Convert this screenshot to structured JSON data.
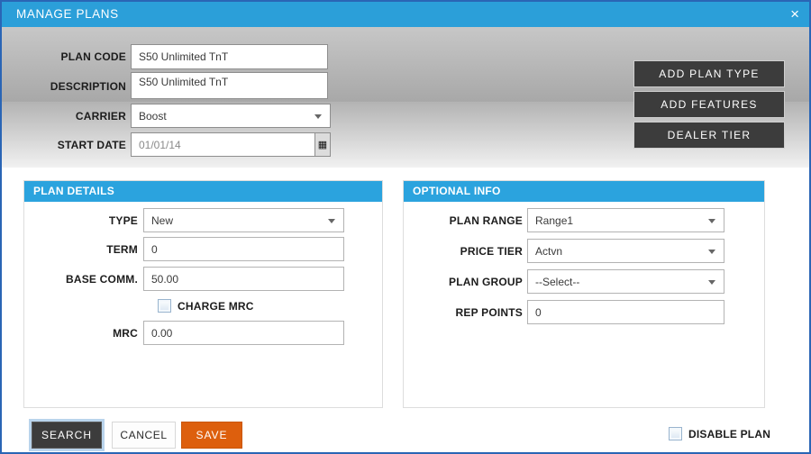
{
  "titlebar": {
    "title": "MANAGE PLANS",
    "close_glyph": "×"
  },
  "header": {
    "plan_code": {
      "label": "PLAN CODE",
      "value": "S50 Unlimited TnT"
    },
    "description": {
      "label": "DESCRIPTION",
      "value": "S50 Unlimited TnT"
    },
    "carrier": {
      "label": "CARRIER",
      "value": "Boost"
    },
    "start_date": {
      "label": "START DATE",
      "value": "01/01/14",
      "calendar_glyph": "▦"
    },
    "actions": [
      {
        "label": "ADD PLAN TYPE"
      },
      {
        "label": "ADD FEATURES"
      },
      {
        "label": "DEALER TIER"
      }
    ]
  },
  "plan_details": {
    "title": "PLAN DETAILS",
    "type": {
      "label": "TYPE",
      "value": "New"
    },
    "term": {
      "label": "TERM",
      "value": "0"
    },
    "base_comm": {
      "label": "BASE COMM.",
      "value": "50.00"
    },
    "charge_mrc": {
      "label": "CHARGE MRC",
      "checked": false
    },
    "mrc": {
      "label": "MRC",
      "value": "0.00"
    }
  },
  "optional_info": {
    "title": "OPTIONAL INFO",
    "plan_range": {
      "label": "PLAN RANGE",
      "value": "Range1"
    },
    "price_tier": {
      "label": "PRICE TIER",
      "value": "Actvn"
    },
    "plan_group": {
      "label": "PLAN GROUP",
      "value": "--Select--"
    },
    "rep_points": {
      "label": "REP POINTS",
      "value": "0"
    }
  },
  "footer": {
    "search_label": "SEARCH",
    "cancel_label": "CANCEL",
    "save_label": "SAVE",
    "disable_plan": {
      "label": "DISABLE PLAN",
      "checked": false
    }
  },
  "colors": {
    "titlebar_blue": "#2b9fd9",
    "panel_header_blue": "#2ba3de",
    "save_orange": "#dd5f0d",
    "dark_button": "#3c3c3c",
    "dialog_border_blue": "#2a65b5"
  }
}
